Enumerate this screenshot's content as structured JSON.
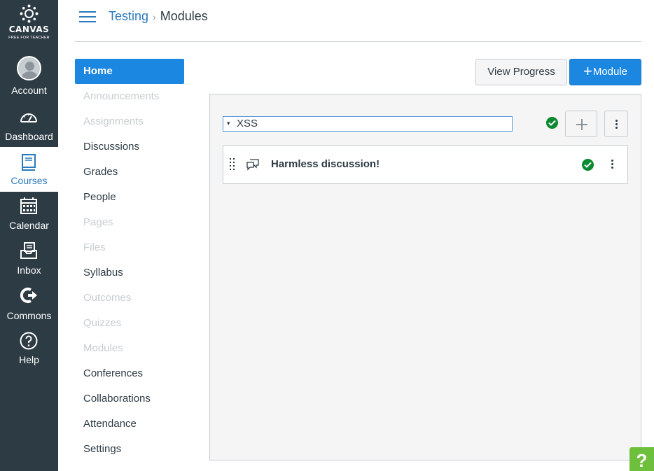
{
  "global_nav": {
    "logo_word": "CANVAS",
    "logo_sub": "FREE FOR TEACHER",
    "items": [
      {
        "label": "Account",
        "icon": "avatar"
      },
      {
        "label": "Dashboard",
        "icon": "dashboard-icon"
      },
      {
        "label": "Courses",
        "icon": "book-icon",
        "active": true
      },
      {
        "label": "Calendar",
        "icon": "calendar-icon"
      },
      {
        "label": "Inbox",
        "icon": "inbox-icon"
      },
      {
        "label": "Commons",
        "icon": "commons-icon"
      },
      {
        "label": "Help",
        "icon": "help-circle-icon"
      }
    ]
  },
  "header": {
    "breadcrumb_course": "Testing",
    "breadcrumb_separator": "›",
    "breadcrumb_current": "Modules"
  },
  "course_nav": {
    "items": [
      {
        "label": "Home",
        "state": "active"
      },
      {
        "label": "Announcements",
        "state": "disabled"
      },
      {
        "label": "Assignments",
        "state": "disabled"
      },
      {
        "label": "Discussions",
        "state": "enabled"
      },
      {
        "label": "Grades",
        "state": "enabled"
      },
      {
        "label": "People",
        "state": "enabled"
      },
      {
        "label": "Pages",
        "state": "disabled"
      },
      {
        "label": "Files",
        "state": "disabled"
      },
      {
        "label": "Syllabus",
        "state": "enabled"
      },
      {
        "label": "Outcomes",
        "state": "disabled"
      },
      {
        "label": "Quizzes",
        "state": "disabled"
      },
      {
        "label": "Modules",
        "state": "disabled"
      },
      {
        "label": "Conferences",
        "state": "enabled"
      },
      {
        "label": "Collaborations",
        "state": "enabled"
      },
      {
        "label": "Attendance",
        "state": "enabled"
      },
      {
        "label": "Settings",
        "state": "enabled"
      }
    ]
  },
  "toolbar": {
    "view_progress_label": "View Progress",
    "add_module_label": "Module"
  },
  "module": {
    "name": "XSS",
    "caret": "▾",
    "published": true,
    "items": [
      {
        "title": "Harmless discussion!",
        "type_icon": "discussion-icon",
        "published": true
      }
    ]
  },
  "help_tab": {
    "label": "?"
  },
  "colors": {
    "nav_bg": "#2d3b45",
    "brand_blue": "#1b87e0",
    "link_blue": "#2b7abc",
    "published_green": "#0b8a2f",
    "help_green": "#6ec03c"
  }
}
